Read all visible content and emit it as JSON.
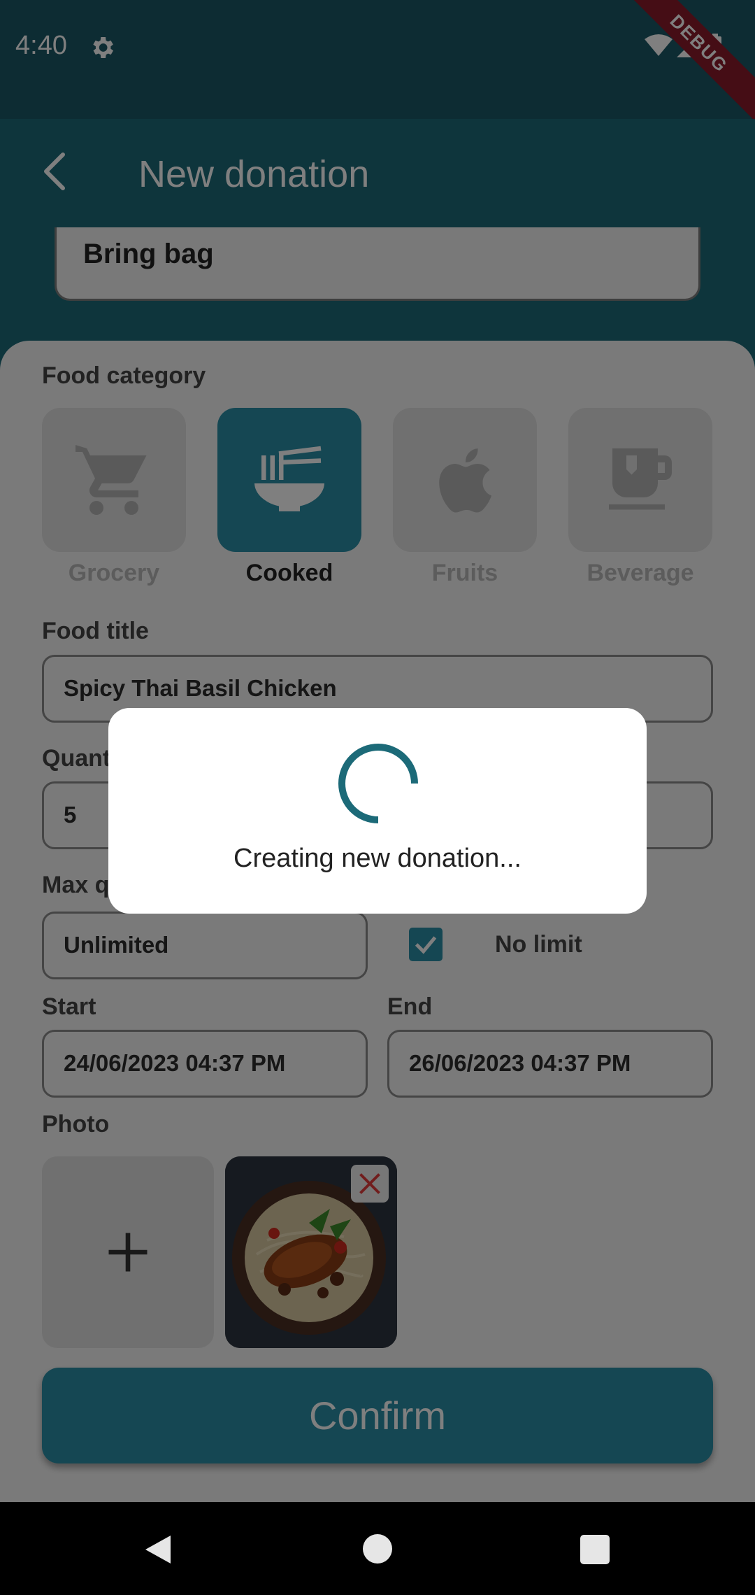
{
  "status_bar": {
    "time": "4:40",
    "debug_label": "DEBUG"
  },
  "app_bar": {
    "title": "New donation"
  },
  "note_field": {
    "value": "Bring bag"
  },
  "food_category": {
    "label": "Food category",
    "items": [
      {
        "label": "Grocery",
        "icon": "cart-icon",
        "selected": false
      },
      {
        "label": "Cooked",
        "icon": "noodle-bowl-icon",
        "selected": true
      },
      {
        "label": "Fruits",
        "icon": "apple-icon",
        "selected": false
      },
      {
        "label": "Beverage",
        "icon": "cup-icon",
        "selected": false
      }
    ]
  },
  "food_title": {
    "label": "Food title",
    "value": "Spicy Thai Basil Chicken"
  },
  "quantity": {
    "label": "Quant",
    "value": "5"
  },
  "max_quantity": {
    "label": "Max q",
    "value": "Unlimited",
    "no_limit_label": "No limit",
    "no_limit_checked": true
  },
  "start": {
    "label": "Start",
    "value": "24/06/2023 04:37 PM"
  },
  "end": {
    "label": "End",
    "value": "26/06/2023 04:37 PM"
  },
  "photo": {
    "label": "Photo"
  },
  "confirm": {
    "label": "Confirm"
  },
  "dialog": {
    "message": "Creating new donation..."
  },
  "colors": {
    "primary": "#2a8fa6",
    "app_bar": "#1c6a78",
    "status_bar": "#1a5966"
  }
}
